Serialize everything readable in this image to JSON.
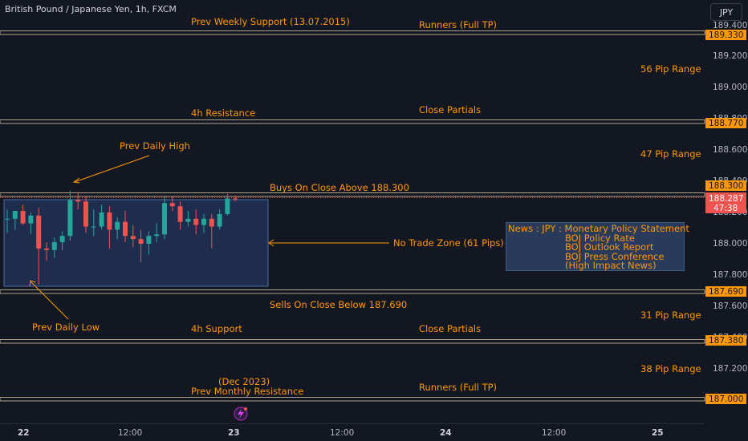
{
  "header": {
    "symbol_title": "British Pound / Japanese Yen, 1h, FXCM",
    "currency_button": "JPY"
  },
  "colors": {
    "background": "#131722",
    "annotation": "#ff9800",
    "level_line": "#b0a58a",
    "bull_candle": "#26a69a",
    "bear_candle": "#ef5350",
    "zone_fill": "#1e2d4d",
    "zone_border": "#4a6fa5",
    "price_label_bg": "#ff9800",
    "current_price_bg": "#ef5350"
  },
  "price_axis": {
    "ticks": [
      "189.400",
      "189.200",
      "189.000",
      "188.800",
      "188.600",
      "188.400",
      "188.200",
      "188.000",
      "187.800",
      "187.600",
      "187.400",
      "187.200"
    ]
  },
  "time_axis": {
    "ticks": [
      "22",
      "12:00",
      "23",
      "12:00",
      "24",
      "12:00",
      "25"
    ]
  },
  "level_labels": [
    {
      "price": "189.330"
    },
    {
      "price": "188.770"
    },
    {
      "price": "188.300"
    },
    {
      "price": "187.690"
    },
    {
      "price": "187.380"
    },
    {
      "price": "187.000"
    }
  ],
  "current_price": {
    "value": "188.287",
    "countdown": "47:38"
  },
  "annotations": {
    "prev_weekly_support": "Prev Weekly Support (13.07.2015)",
    "runners_top": "Runners (Full TP)",
    "range_56": "56 Pip Range",
    "resistance_4h": "4h Resistance",
    "close_partials_top": "Close Partials",
    "prev_daily_high": "Prev Daily High",
    "range_47": "47 Pip Range",
    "buys_on_close": "Buys On Close Above 188.300",
    "no_trade_zone": "No Trade Zone (61 Pips)",
    "sells_on_close": "Sells On Close Below 187.690",
    "range_31": "31 Pip Range",
    "prev_daily_low": "Prev Daily Low",
    "support_4h": "4h Support",
    "close_partials_bottom": "Close Partials",
    "range_38": "38 Pip Range",
    "dec_2023": "(Dec 2023)",
    "prev_monthly_resistance": "Prev Monthly Resistance",
    "runners_bottom": "Runners (Full TP)"
  },
  "news": {
    "line1": "News : JPY : Monetary Policy Statement",
    "line2": "BOJ Policy Rate",
    "line3": "BOJ Outlook Report",
    "line4": "BOJ Press Conference",
    "line5": "(High Impact News)"
  },
  "event_icon": "lightning-icon",
  "chart_data": {
    "type": "candlestick",
    "candles": [
      {
        "o": 188.16,
        "h": 188.22,
        "l": 188.07,
        "c": 188.16
      },
      {
        "o": 188.16,
        "h": 188.21,
        "l": 188.09,
        "c": 188.21
      },
      {
        "o": 188.21,
        "h": 188.25,
        "l": 188.12,
        "c": 188.13
      },
      {
        "o": 188.13,
        "h": 188.2,
        "l": 188.06,
        "c": 188.18
      },
      {
        "o": 188.18,
        "h": 188.23,
        "l": 187.74,
        "c": 187.97
      },
      {
        "o": 187.97,
        "h": 188.01,
        "l": 187.89,
        "c": 187.96
      },
      {
        "o": 187.96,
        "h": 188.04,
        "l": 187.91,
        "c": 188.01
      },
      {
        "o": 188.01,
        "h": 188.08,
        "l": 187.96,
        "c": 188.05
      },
      {
        "o": 188.05,
        "h": 188.34,
        "l": 188.02,
        "c": 188.28
      },
      {
        "o": 188.28,
        "h": 188.33,
        "l": 188.22,
        "c": 188.27
      },
      {
        "o": 188.27,
        "h": 188.3,
        "l": 188.07,
        "c": 188.11
      },
      {
        "o": 188.11,
        "h": 188.22,
        "l": 188.05,
        "c": 188.11
      },
      {
        "o": 188.11,
        "h": 188.25,
        "l": 188.09,
        "c": 188.2
      },
      {
        "o": 188.2,
        "h": 188.24,
        "l": 187.97,
        "c": 188.09
      },
      {
        "o": 188.09,
        "h": 188.17,
        "l": 188.03,
        "c": 188.14
      },
      {
        "o": 188.14,
        "h": 188.21,
        "l": 188.01,
        "c": 188.05
      },
      {
        "o": 188.05,
        "h": 188.12,
        "l": 187.98,
        "c": 188.03
      },
      {
        "o": 188.03,
        "h": 188.09,
        "l": 187.88,
        "c": 188.0
      },
      {
        "o": 188.0,
        "h": 188.08,
        "l": 187.93,
        "c": 188.05
      },
      {
        "o": 188.05,
        "h": 188.13,
        "l": 188.01,
        "c": 188.06
      },
      {
        "o": 188.06,
        "h": 188.3,
        "l": 188.03,
        "c": 188.26
      },
      {
        "o": 188.26,
        "h": 188.3,
        "l": 188.21,
        "c": 188.24
      },
      {
        "o": 188.24,
        "h": 188.27,
        "l": 188.09,
        "c": 188.14
      },
      {
        "o": 188.14,
        "h": 188.21,
        "l": 188.11,
        "c": 188.16
      },
      {
        "o": 188.16,
        "h": 188.22,
        "l": 188.06,
        "c": 188.12
      },
      {
        "o": 188.12,
        "h": 188.19,
        "l": 188.07,
        "c": 188.16
      },
      {
        "o": 188.16,
        "h": 188.19,
        "l": 187.97,
        "c": 188.11
      },
      {
        "o": 188.11,
        "h": 188.22,
        "l": 188.09,
        "c": 188.19
      },
      {
        "o": 188.19,
        "h": 188.32,
        "l": 188.18,
        "c": 188.29
      },
      {
        "o": 188.29,
        "h": 188.31,
        "l": 188.27,
        "c": 188.287
      }
    ]
  }
}
